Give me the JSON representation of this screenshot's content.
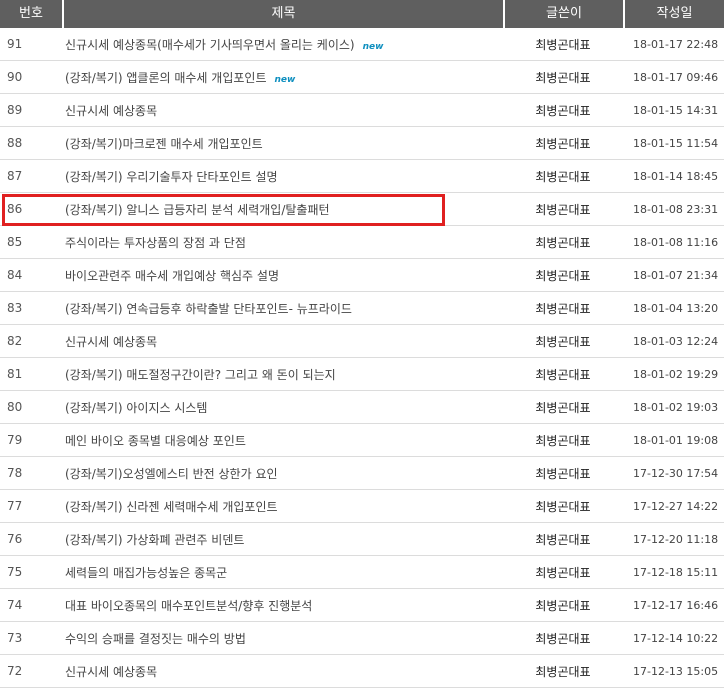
{
  "header": {
    "num": "번호",
    "title": "제목",
    "author": "글쓴이",
    "date": "작성일"
  },
  "rows": [
    {
      "num": "91",
      "title": "신규시세 예상종목(매수세가 기사띄우면서 올리는 케이스)",
      "author": "최병곤대표",
      "date": "18-01-17 22:48",
      "badge": "new"
    },
    {
      "num": "90",
      "title": "(강좌/복기) 앱클론의 매수세 개입포인트",
      "author": "최병곤대표",
      "date": "18-01-17 09:46",
      "badge": "new"
    },
    {
      "num": "89",
      "title": "신규시세 예상종목",
      "author": "최병곤대표",
      "date": "18-01-15 14:31",
      "badge": ""
    },
    {
      "num": "88",
      "title": "(강좌/복기)마크로젠 매수세 개입포인트",
      "author": "최병곤대표",
      "date": "18-01-15 11:54",
      "badge": ""
    },
    {
      "num": "87",
      "title": "(강좌/복기) 우리기술투자 단타포인트 설명",
      "author": "최병곤대표",
      "date": "18-01-14 18:45",
      "badge": ""
    },
    {
      "num": "86",
      "title": "(강좌/복기) 알니스 급등자리 분석 세력개입/탈출패턴",
      "author": "최병곤대표",
      "date": "18-01-08 23:31",
      "badge": ""
    },
    {
      "num": "85",
      "title": "주식이라는 투자상품의 장점 과 단점",
      "author": "최병곤대표",
      "date": "18-01-08 11:16",
      "badge": ""
    },
    {
      "num": "84",
      "title": "바이오관련주 매수세 개입예상 핵심주 설명",
      "author": "최병곤대표",
      "date": "18-01-07 21:34",
      "badge": ""
    },
    {
      "num": "83",
      "title": "(강좌/복기) 연속급등후 하락출발 단타포인트- 뉴프라이드",
      "author": "최병곤대표",
      "date": "18-01-04 13:20",
      "badge": ""
    },
    {
      "num": "82",
      "title": "신규시세 예상종목",
      "author": "최병곤대표",
      "date": "18-01-03 12:24",
      "badge": ""
    },
    {
      "num": "81",
      "title": "(강좌/복기) 매도절정구간이란? 그리고 왜 돈이 되는지",
      "author": "최병곤대표",
      "date": "18-01-02 19:29",
      "badge": ""
    },
    {
      "num": "80",
      "title": "(강좌/복기) 아이지스 시스템",
      "author": "최병곤대표",
      "date": "18-01-02 19:03",
      "badge": ""
    },
    {
      "num": "79",
      "title": "메인 바이오 종목별 대응예상 포인트",
      "author": "최병곤대표",
      "date": "18-01-01 19:08",
      "badge": ""
    },
    {
      "num": "78",
      "title": "(강좌/복기)오성엘에스티 반전 상한가 요인",
      "author": "최병곤대표",
      "date": "17-12-30 17:54",
      "badge": ""
    },
    {
      "num": "77",
      "title": "(강좌/복기) 신라젠 세력매수세 개입포인트",
      "author": "최병곤대표",
      "date": "17-12-27 14:22",
      "badge": ""
    },
    {
      "num": "76",
      "title": "(강좌/복기) 가상화폐 관련주 비덴트",
      "author": "최병곤대표",
      "date": "17-12-20 11:18",
      "badge": ""
    },
    {
      "num": "75",
      "title": "세력들의 매집가능성높은 종목군",
      "author": "최병곤대표",
      "date": "17-12-18 15:11",
      "badge": ""
    },
    {
      "num": "74",
      "title": "대표 바이오종목의 매수포인트분석/향후 진행분석",
      "author": "최병곤대표",
      "date": "17-12-17 16:46",
      "badge": ""
    },
    {
      "num": "73",
      "title": "수익의 승패를 결정짓는 매수의 방법",
      "author": "최병곤대표",
      "date": "17-12-14 10:22",
      "badge": ""
    },
    {
      "num": "72",
      "title": "신규시세 예상종목",
      "author": "최병곤대표",
      "date": "17-12-13 15:05",
      "badge": ""
    }
  ],
  "colors": {
    "header_bg": "#5f5f5f",
    "highlight_border": "#e02020",
    "new_badge": "#0e8fbf"
  }
}
